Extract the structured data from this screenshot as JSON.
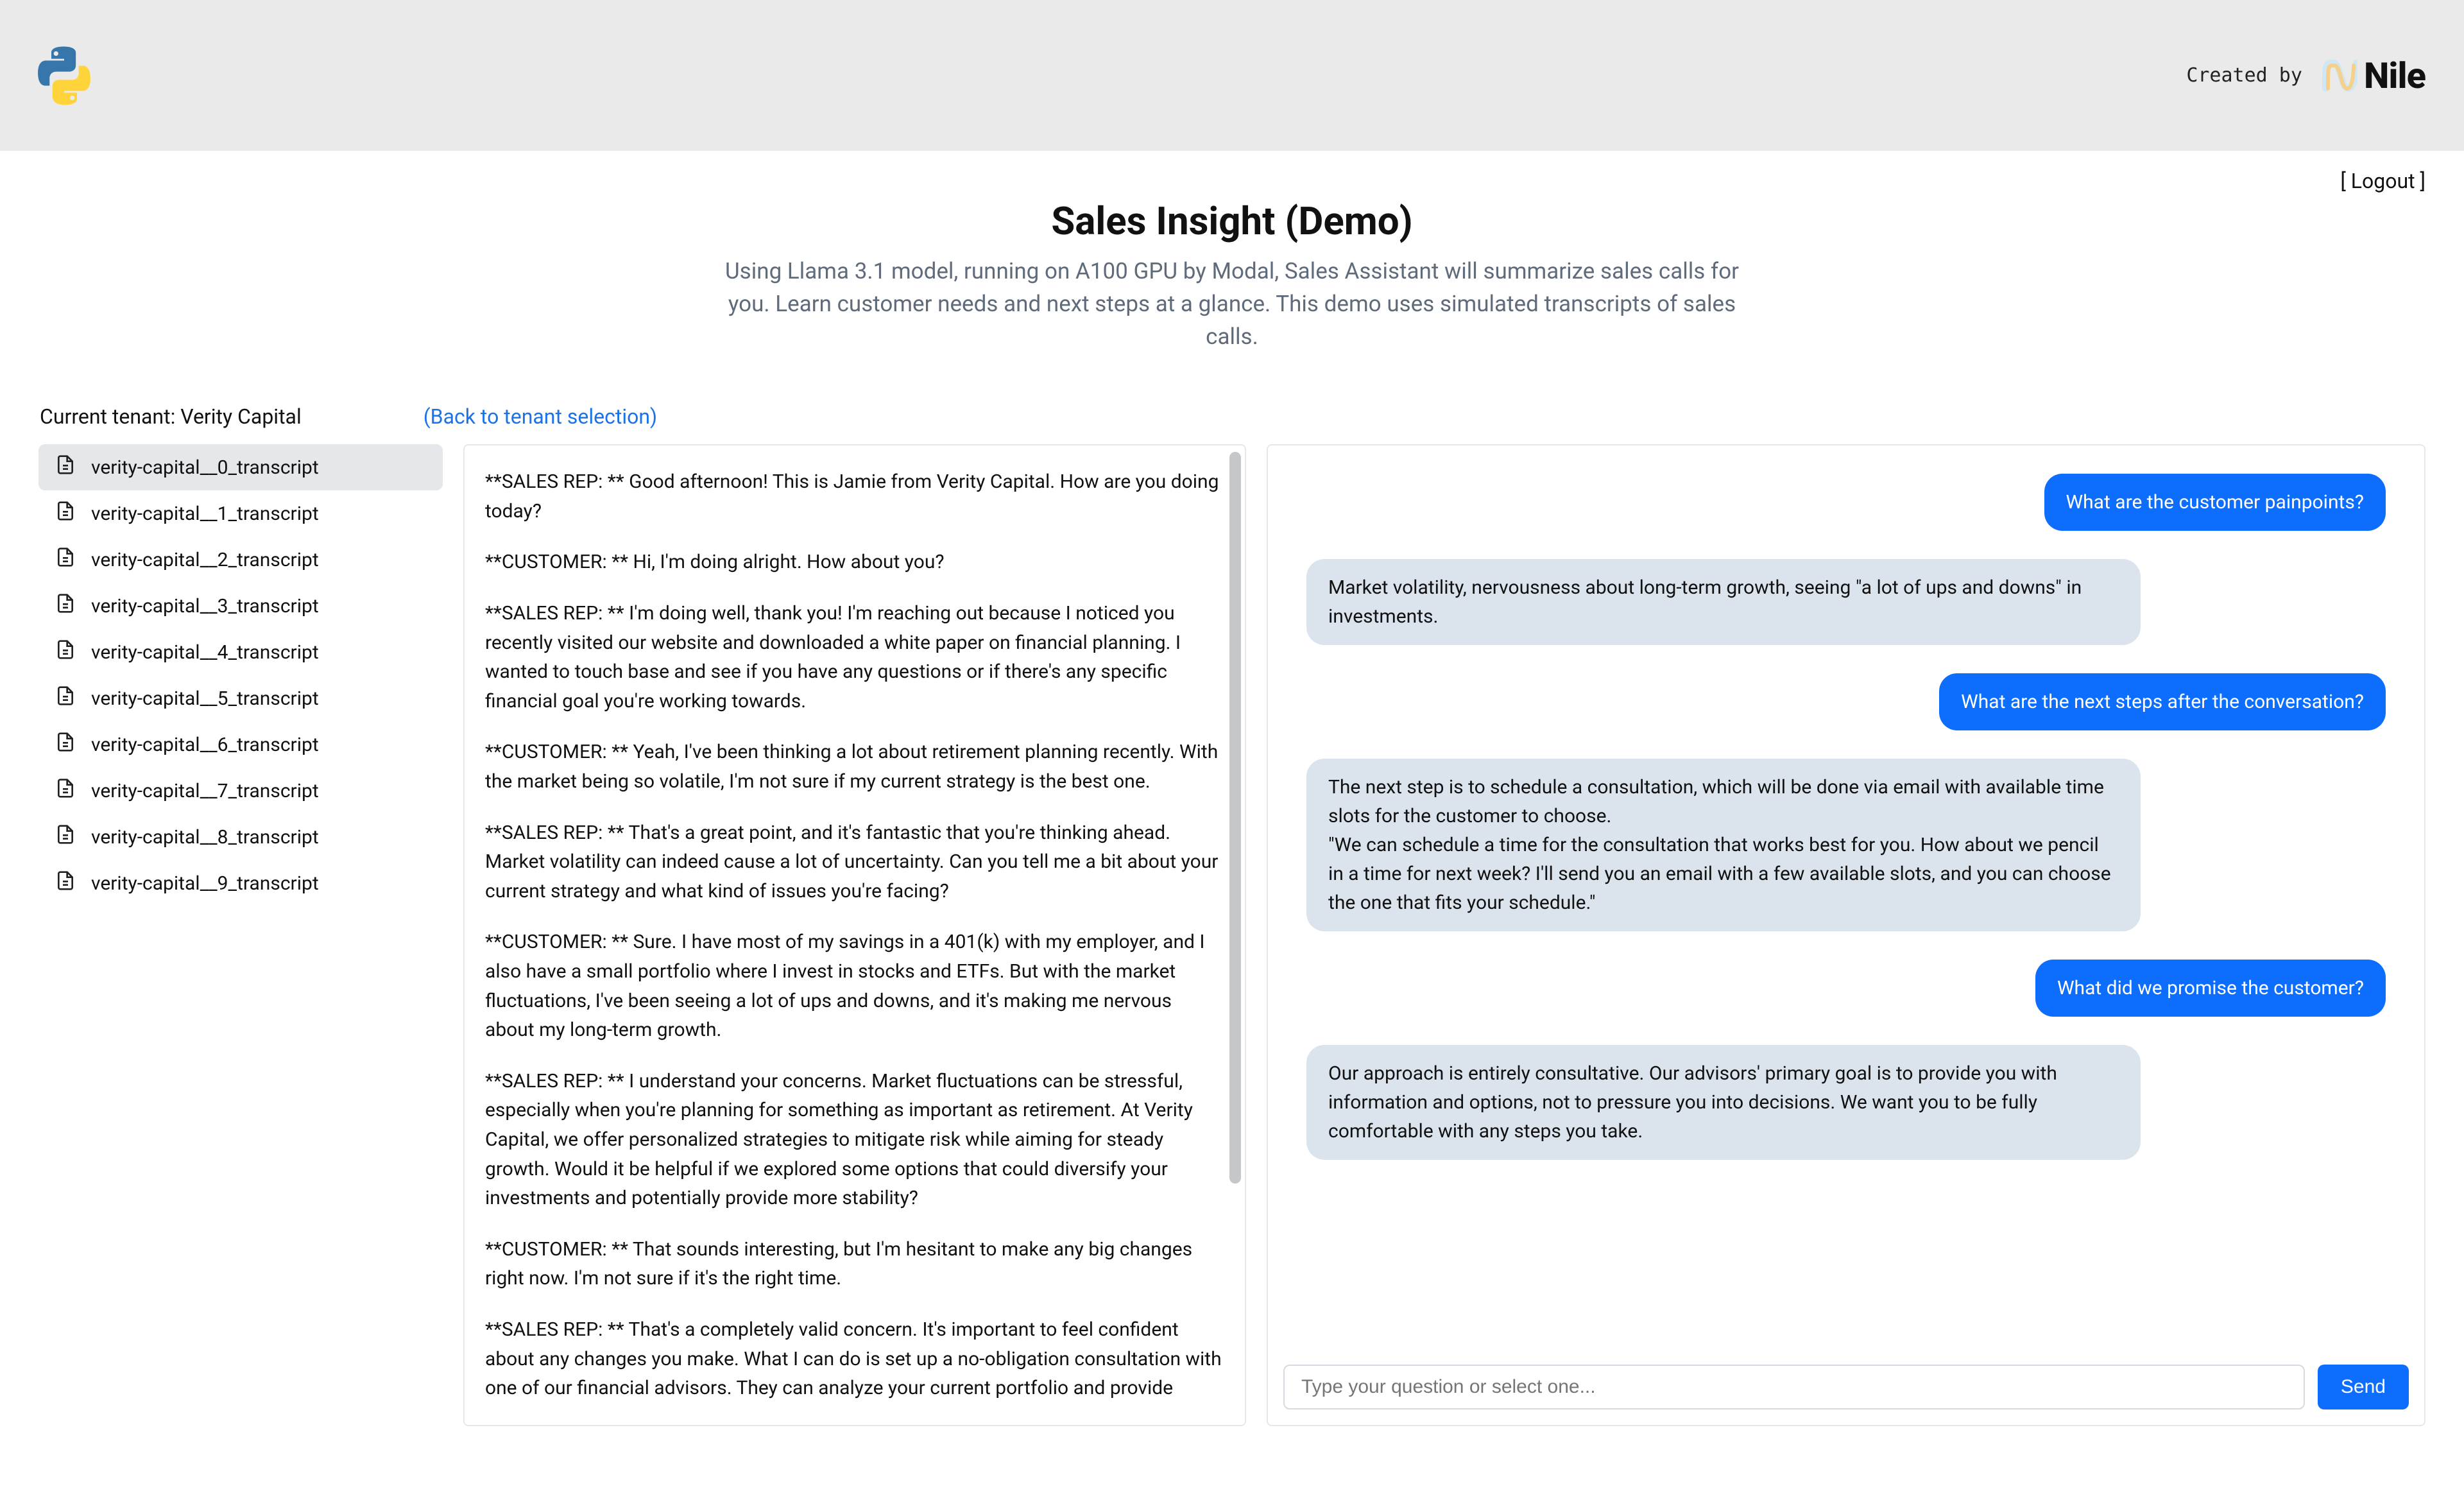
{
  "header": {
    "created_by_label": "Created by",
    "brand_name": "Nile"
  },
  "auth": {
    "logout_label": "[ Logout ]"
  },
  "title": "Sales Insight (Demo)",
  "subtitle": "Using Llama 3.1 model, running on A100 GPU by Modal, Sales Assistant will summarize sales calls for you. Learn customer needs and next steps at a glance. This demo uses simulated transcripts of sales calls.",
  "tenant": {
    "label_prefix": "Current tenant: ",
    "name": "Verity Capital",
    "back_link": "(Back to tenant selection)"
  },
  "sidebar": {
    "items": [
      {
        "label": "verity-capital__0_transcript",
        "active": true
      },
      {
        "label": "verity-capital__1_transcript",
        "active": false
      },
      {
        "label": "verity-capital__2_transcript",
        "active": false
      },
      {
        "label": "verity-capital__3_transcript",
        "active": false
      },
      {
        "label": "verity-capital__4_transcript",
        "active": false
      },
      {
        "label": "verity-capital__5_transcript",
        "active": false
      },
      {
        "label": "verity-capital__6_transcript",
        "active": false
      },
      {
        "label": "verity-capital__7_transcript",
        "active": false
      },
      {
        "label": "verity-capital__8_transcript",
        "active": false
      },
      {
        "label": "verity-capital__9_transcript",
        "active": false
      }
    ]
  },
  "transcript": {
    "paragraphs": [
      "**SALES REP: ** Good afternoon! This is Jamie from Verity Capital. How are you doing today?",
      "**CUSTOMER: ** Hi, I'm doing alright. How about you?",
      "**SALES REP: ** I'm doing well, thank you! I'm reaching out because I noticed you recently visited our website and downloaded a white paper on financial planning. I wanted to touch base and see if you have any questions or if there's any specific financial goal you're working towards.",
      "**CUSTOMER: ** Yeah, I've been thinking a lot about retirement planning recently. With the market being so volatile, I'm not sure if my current strategy is the best one.",
      "**SALES REP: ** That's a great point, and it's fantastic that you're thinking ahead. Market volatility can indeed cause a lot of uncertainty. Can you tell me a bit about your current strategy and what kind of issues you're facing?",
      "**CUSTOMER: ** Sure. I have most of my savings in a 401(k) with my employer, and I also have a small portfolio where I invest in stocks and ETFs. But with the market fluctuations, I've been seeing a lot of ups and downs, and it's making me nervous about my long-term growth.",
      "**SALES REP: ** I understand your concerns. Market fluctuations can be stressful, especially when you're planning for something as important as retirement. At Verity Capital, we offer personalized strategies to mitigate risk while aiming for steady growth. Would it be helpful if we explored some options that could diversify your investments and potentially provide more stability?",
      "**CUSTOMER: ** That sounds interesting, but I'm hesitant to make any big changes right now. I'm not sure if it's the right time.",
      "**SALES REP: ** That's a completely valid concern. It's important to feel confident about any changes you make. What I can do is set up a no-obligation consultation with one of our financial advisors. They can analyze your current portfolio and provide recommendations based"
    ]
  },
  "chat": {
    "messages": [
      {
        "role": "user",
        "text": "What are the customer painpoints?"
      },
      {
        "role": "assistant",
        "text": "Market volatility, nervousness about long-term growth, seeing \"a lot of ups and downs\" in investments."
      },
      {
        "role": "user",
        "text": "What are the next steps after the conversation?"
      },
      {
        "role": "assistant",
        "text": "The next step is to schedule a consultation, which will be done via email with available time slots for the customer to choose.\n\"We can schedule a time for the consultation that works best for you. How about we pencil in a time for next week? I'll send you an email with a few available slots, and you can choose the one that fits your schedule.\""
      },
      {
        "role": "user",
        "text": "What did we promise the customer?"
      },
      {
        "role": "assistant",
        "text": "Our approach is entirely consultative. Our advisors' primary goal is to provide you with information and options, not to pressure you into decisions. We want you to be fully comfortable with any steps you take."
      }
    ],
    "input_placeholder": "Type your question or select one...",
    "send_label": "Send"
  }
}
